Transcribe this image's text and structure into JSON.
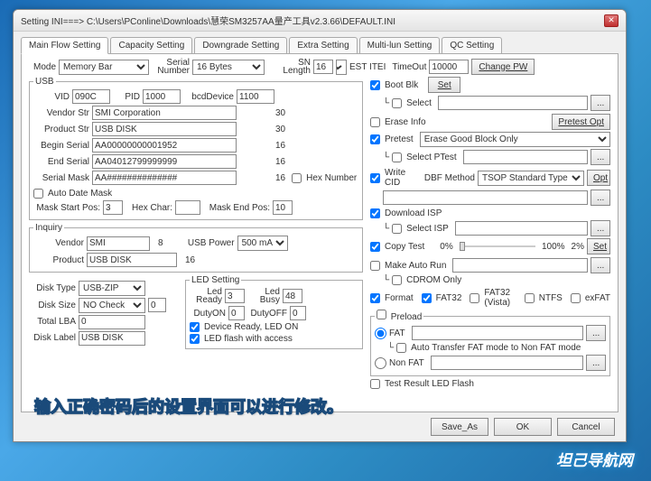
{
  "title": "Setting  INI===>  C:\\Users\\PConline\\Downloads\\慧荣SM3257AA量产工具v2.3.66\\DEFAULT.INI",
  "tabs": [
    "Main Flow Setting",
    "Capacity Setting",
    "Downgrade Setting",
    "Extra Setting",
    "Multi-lun Setting",
    "QC Setting"
  ],
  "toprow": {
    "mode_lbl": "Mode",
    "mode_val": "Memory Bar",
    "serial_num_lbl": "Serial\nNumber",
    "serial_val": "16 Bytes",
    "sn_lbl": "SN\nLength",
    "sn_val": "16",
    "test_itei": "EST ITEI",
    "timeout_lbl": "TimeOut",
    "timeout_val": "10000",
    "change_pw": "Change PW"
  },
  "usb": {
    "legend": "USB",
    "vid_lbl": "VID",
    "vid": "090C",
    "pid_lbl": "PID",
    "pid": "1000",
    "bcd_lbl": "bcdDevice",
    "bcd": "1100",
    "vendor_str_lbl": "Vendor Str",
    "vendor_str": "SMI Corporation",
    "vs_len": "30",
    "product_str_lbl": "Product Str",
    "product_str": "USB DISK",
    "ps_len": "30",
    "begin_lbl": "Begin Serial",
    "begin": "AA00000000001952",
    "bs_len": "16",
    "end_lbl": "End Serial",
    "end": "AA04012799999999",
    "es_len": "16",
    "mask_lbl": "Serial Mask",
    "mask": "AA##############",
    "sm_len": "16",
    "hex_lbl": "Hex Number",
    "auto_date": "Auto Date Mask",
    "msp_lbl": "Mask Start Pos:",
    "msp": "3",
    "hc_lbl": "Hex Char:",
    "hc": "",
    "mep_lbl": "Mask End Pos:",
    "mep": "10"
  },
  "inquiry": {
    "legend": "Inquiry",
    "vendor_lbl": "Vendor",
    "vendor": "SMI",
    "vlen": "8",
    "usb_power_lbl": "USB Power",
    "usb_power": "500 mA",
    "product_lbl": "Product",
    "product": "USB DISK",
    "plen": "16"
  },
  "disk": {
    "type_lbl": "Disk Type",
    "type": "USB-ZIP",
    "size_lbl": "Disk Size",
    "size": "NO Check",
    "size_val": "0",
    "lba_lbl": "Total LBA",
    "lba": "0",
    "label_lbl": "Disk Label",
    "label": "USB DISK"
  },
  "led": {
    "legend": "LED Setting",
    "ready_lbl": "Led\nReady",
    "ready": "3",
    "busy_lbl": "Led\nBusy",
    "busy": "48",
    "dutyon_lbl": "DutyON",
    "dutyon": "0",
    "dutyoff_lbl": "DutyOFF",
    "dutyoff": "0",
    "ready_on": "Device Ready, LED ON",
    "flash": "LED flash with access"
  },
  "right": {
    "boot": "Boot Blk",
    "set": "Set",
    "sel": "Select",
    "dot": "...",
    "erase": "Erase Info",
    "pretest_opt": "Pretest Opt",
    "pretest": "Pretest",
    "pretest_val": "Erase Good Block Only",
    "sel_ptest": "Select PTest",
    "wcid": "Write CID",
    "dbf_lbl": "DBF Method",
    "dbf": "TSOP Standard Type",
    "opt": "Opt",
    "dlisp": "Download ISP",
    "sel_isp": "Select ISP",
    "copy": "Copy Test",
    "copy_from": "0%",
    "copy_to": "100%",
    "copy_val": "2%",
    "set2": "Set",
    "autorun": "Make Auto Run",
    "cdrom": "CDROM Only",
    "format": "Format",
    "fat32": "FAT32",
    "fat32v": "FAT32 (Vista)",
    "ntfs": "NTFS",
    "exfat": "exFAT",
    "preload": "Preload",
    "fat": "FAT",
    "auto_transfer": "Auto Transfer FAT mode to Non FAT mode",
    "nonfat": "Non FAT",
    "test_result": "Test Result LED Flash"
  },
  "buttons": {
    "save": "Save_As",
    "ok": "OK",
    "cancel": "Cancel"
  },
  "annotation": "输入正确密码后的设置界面可以进行修改。",
  "watermark": "坦己导航网"
}
